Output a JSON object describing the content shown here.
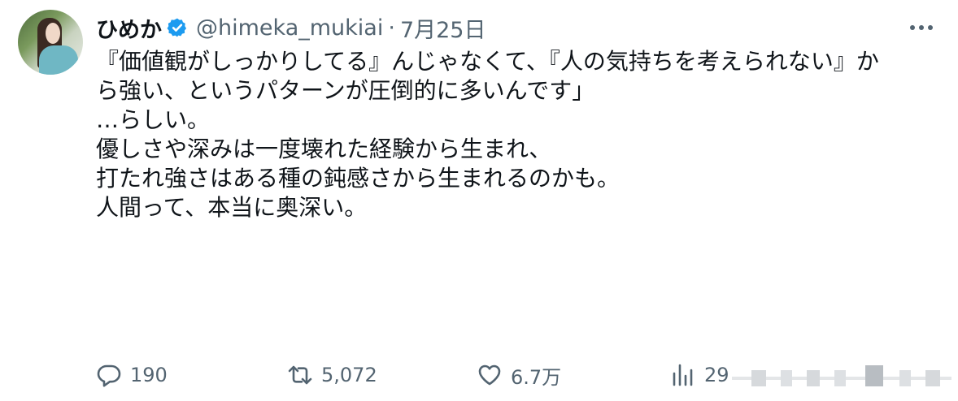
{
  "tweet": {
    "author": {
      "display_name": "ひめか",
      "handle": "@himeka_mukiai",
      "verified": true
    },
    "dot": "·",
    "date": "7月25日",
    "text_lines": [
      "『価値観がしっかりしてる』んじゃなくて、『人の気持ちを考えられない』か",
      "ら強い、というパターンが圧倒的に多いんです」",
      "",
      "…らしい。",
      "",
      "優しさや深みは一度壊れた経験から生まれ、",
      "打たれ強さはある種の鈍感さから生まれるのかも。",
      "",
      "人間って、本当に奥深い。"
    ],
    "actions": {
      "reply_count": "190",
      "retweet_count": "5,072",
      "like_count": "6.7万",
      "views_count": "29"
    },
    "icons": {
      "verified": "verified-badge-icon",
      "more": "more-icon",
      "reply": "reply-icon",
      "retweet": "retweet-icon",
      "like": "heart-icon",
      "views": "views-icon"
    },
    "colors": {
      "text": "#0f1419",
      "secondary": "#536471",
      "verified": "#1d9bf0"
    }
  }
}
